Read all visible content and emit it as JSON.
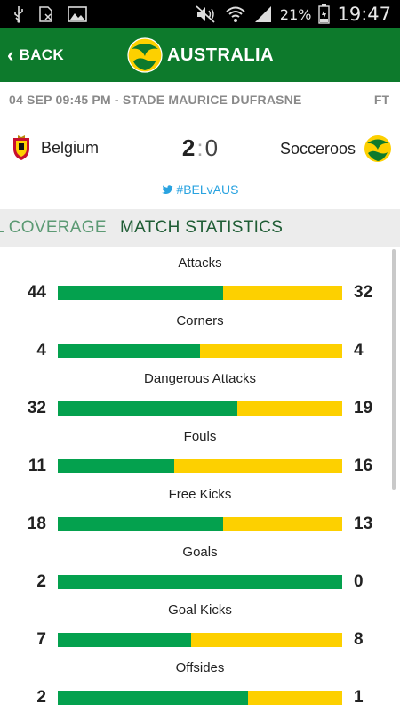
{
  "status_bar": {
    "battery": "21%",
    "time": "19:47"
  },
  "app_bar": {
    "back_label": "BACK",
    "brand": "AUSTRALIA"
  },
  "match": {
    "info": "04 SEP 09:45 PM - STADE MAURICE DUFRASNE",
    "status": "FT",
    "home_team": "Belgium",
    "away_team": "Socceroos",
    "home_score": "2",
    "score_sep": ":",
    "away_score": "0",
    "hashtag": "#BELvAUS"
  },
  "tabs": [
    {
      "label": "L COVERAGE"
    },
    {
      "label": "MATCH STATISTICS"
    }
  ],
  "colors": {
    "home": "#04a14e",
    "away": "#fdd000",
    "header": "#0d7a2c",
    "hashtag": "#2aa3e0"
  },
  "stats": [
    {
      "label": "Attacks",
      "home": "44",
      "away": "32",
      "home_share": 0.58
    },
    {
      "label": "Corners",
      "home": "4",
      "away": "4",
      "home_share": 0.5
    },
    {
      "label": "Dangerous Attacks",
      "home": "32",
      "away": "19",
      "home_share": 0.63
    },
    {
      "label": "Fouls",
      "home": "11",
      "away": "16",
      "home_share": 0.41
    },
    {
      "label": "Free Kicks",
      "home": "18",
      "away": "13",
      "home_share": 0.58
    },
    {
      "label": "Goals",
      "home": "2",
      "away": "0",
      "home_share": 1.0
    },
    {
      "label": "Goal Kicks",
      "home": "7",
      "away": "8",
      "home_share": 0.47
    },
    {
      "label": "Offsides",
      "home": "2",
      "away": "1",
      "home_share": 0.67
    }
  ]
}
